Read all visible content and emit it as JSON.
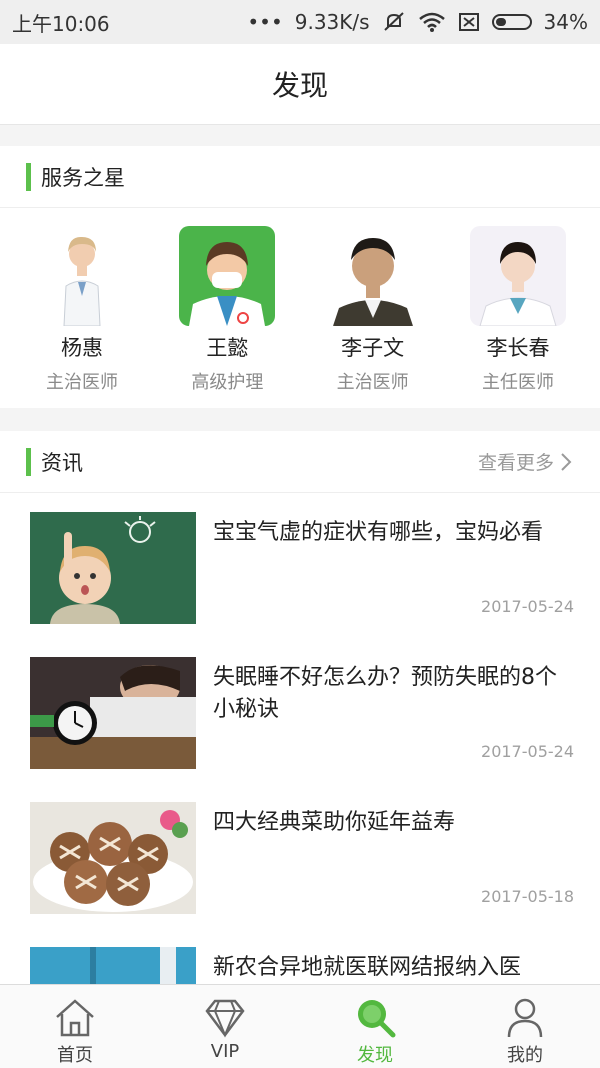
{
  "status_bar": {
    "time": "上午10:06",
    "speed": "9.33K/s",
    "battery": "34%",
    "battery_level": 0.34
  },
  "header": {
    "title": "发现"
  },
  "stars_section": {
    "title": "服务之星",
    "doctors": [
      {
        "name": "杨惠",
        "title": "主治医师"
      },
      {
        "name": "王懿",
        "title": "高级护理"
      },
      {
        "name": "李子文",
        "title": "主治医师"
      },
      {
        "name": "李长春",
        "title": "主任医师"
      }
    ]
  },
  "news_section": {
    "title": "资讯",
    "more_label": "查看更多",
    "items": [
      {
        "title": "宝宝气虚的症状有哪些，宝妈必看",
        "date": "2017-05-24"
      },
      {
        "title": "失眠睡不好怎么办？预防失眠的8个小秘诀",
        "date": "2017-05-24"
      },
      {
        "title": "四大经典菜助你延年益寿",
        "date": "2017-05-18"
      },
      {
        "title": "新农合异地就医联网结报纳入医",
        "date": ""
      }
    ]
  },
  "tabbar": {
    "accent": "#53b83f",
    "tabs": [
      {
        "label": "首页",
        "icon": "home-icon"
      },
      {
        "label": "VIP",
        "icon": "diamond-icon"
      },
      {
        "label": "发现",
        "icon": "search-icon"
      },
      {
        "label": "我的",
        "icon": "user-icon"
      }
    ]
  }
}
